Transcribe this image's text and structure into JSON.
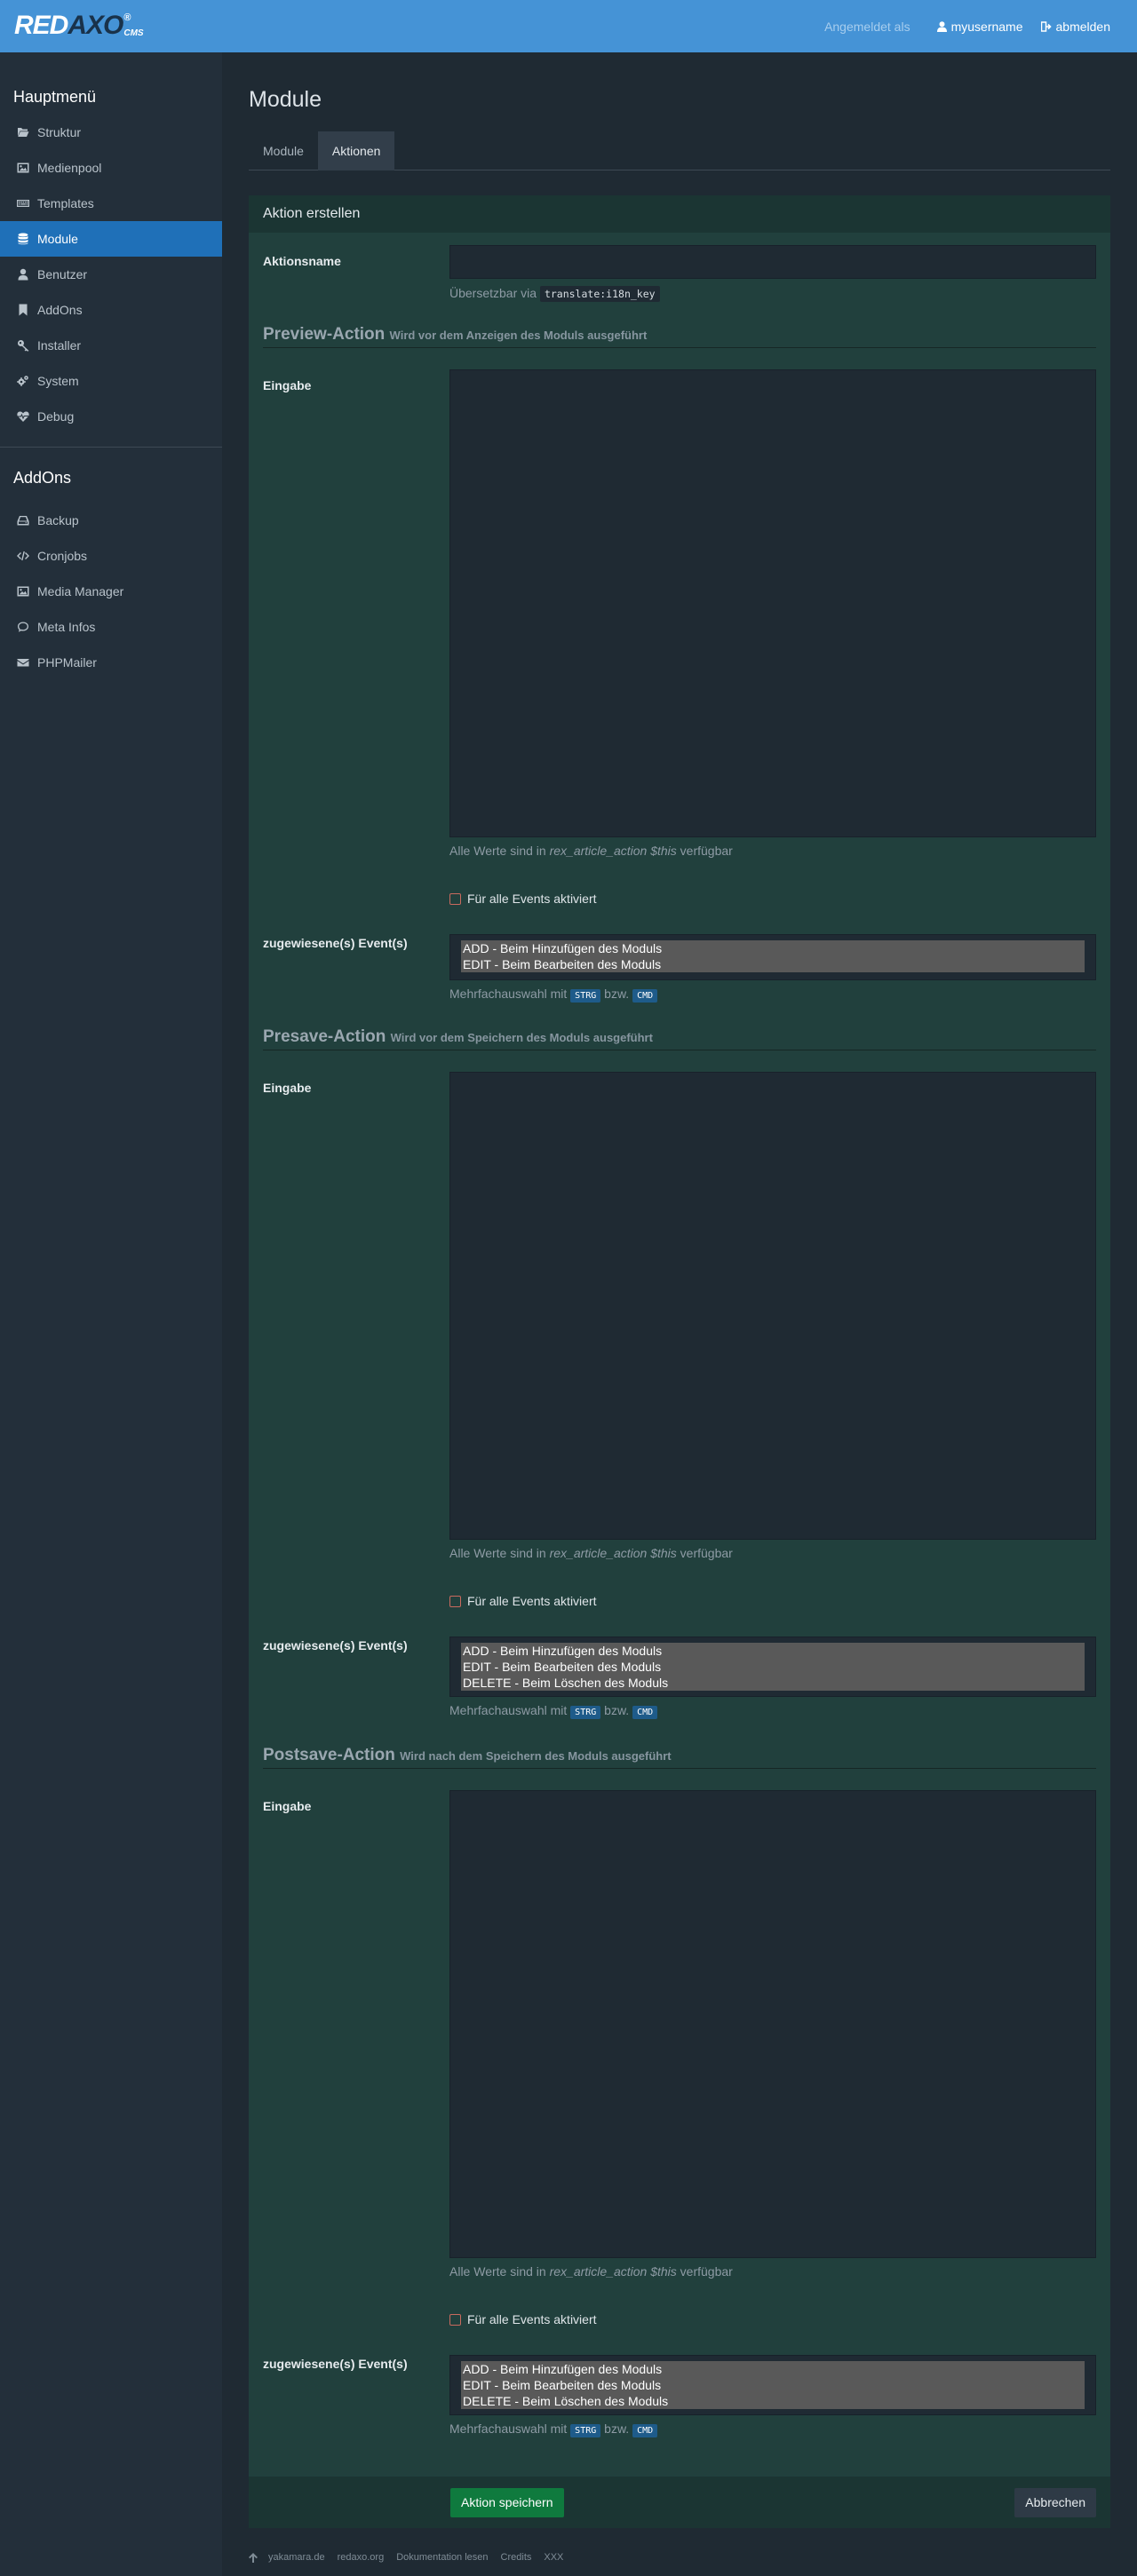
{
  "header": {
    "logo_red": "RED",
    "logo_axo": "AXO",
    "logo_reg": "®",
    "logo_cms": "CMS",
    "logged_in_as": "Angemeldet als",
    "username": "myusername",
    "logout": "abmelden"
  },
  "sidebar": {
    "main_title": "Hauptmenü",
    "main_items": [
      {
        "label": "Struktur",
        "icon": "folder-open-icon"
      },
      {
        "label": "Medienpool",
        "icon": "image-icon"
      },
      {
        "label": "Templates",
        "icon": "keyboard-icon"
      },
      {
        "label": "Module",
        "icon": "database-icon"
      },
      {
        "label": "Benutzer",
        "icon": "user-icon"
      },
      {
        "label": "AddOns",
        "icon": "bookmark-icon"
      },
      {
        "label": "Installer",
        "icon": "key-icon"
      },
      {
        "label": "System",
        "icon": "gears-icon"
      },
      {
        "label": "Debug",
        "icon": "heartbeat-icon"
      }
    ],
    "active_item": "Module",
    "addons_title": "AddOns",
    "addon_items": [
      {
        "label": "Backup",
        "icon": "hdd-icon"
      },
      {
        "label": "Cronjobs",
        "icon": "code-icon"
      },
      {
        "label": "Media Manager",
        "icon": "image-icon"
      },
      {
        "label": "Meta Infos",
        "icon": "comment-icon"
      },
      {
        "label": "PHPMailer",
        "icon": "envelope-icon"
      }
    ]
  },
  "main": {
    "title": "Module",
    "tabs": [
      {
        "label": "Module",
        "active": false
      },
      {
        "label": "Aktionen",
        "active": true
      }
    ],
    "panel_title": "Aktion erstellen",
    "action_name_label": "Aktionsname",
    "action_name_value": "",
    "translate_help": "Übersetzbar via",
    "translate_key": "translate:i18n_key",
    "sections": [
      {
        "title": "Preview-Action",
        "subtitle": "Wird vor dem Anzeigen des Moduls ausgeführt",
        "input_label": "Eingabe",
        "help_pre": "Alle Werte sind in",
        "help_em": "rex_article_action $this",
        "help_post": "verfügbar",
        "checkbox_label": "Für alle Events aktiviert",
        "events_label": "zugewiesene(s) Event(s)",
        "options": [
          "ADD - Beim Hinzufügen des Moduls",
          "EDIT - Beim Bearbeiten des Moduls"
        ]
      },
      {
        "title": "Presave-Action",
        "subtitle": "Wird vor dem Speichern des Moduls ausgeführt",
        "input_label": "Eingabe",
        "help_pre": "Alle Werte sind in",
        "help_em": "rex_article_action $this",
        "help_post": "verfügbar",
        "checkbox_label": "Für alle Events aktiviert",
        "events_label": "zugewiesene(s) Event(s)",
        "options": [
          "ADD - Beim Hinzufügen des Moduls",
          "EDIT - Beim Bearbeiten des Moduls",
          "DELETE - Beim Löschen des Moduls"
        ]
      },
      {
        "title": "Postsave-Action",
        "subtitle": "Wird nach dem Speichern des Moduls ausgeführt",
        "input_label": "Eingabe",
        "help_pre": "Alle Werte sind in",
        "help_em": "rex_article_action $this",
        "help_post": "verfügbar",
        "checkbox_label": "Für alle Events aktiviert",
        "events_label": "zugewiesene(s) Event(s)",
        "options": [
          "ADD - Beim Hinzufügen des Moduls",
          "EDIT - Beim Bearbeiten des Moduls",
          "DELETE - Beim Löschen des Moduls"
        ]
      }
    ],
    "multi_help_pre": "Mehrfachauswahl mit",
    "multi_key1": "STRG",
    "multi_help_mid": "bzw.",
    "multi_key2": "CMD",
    "save_button": "Aktion speichern",
    "cancel_button": "Abbrechen"
  },
  "footer": {
    "links": [
      "yakamara.de",
      "redaxo.org",
      "Dokumentation lesen",
      "Credits",
      "XXX"
    ]
  },
  "colors": {
    "topbar": "#4593d6",
    "sidebar": "#232f3a",
    "active": "#1f70b8",
    "panel": "#21403d",
    "save": "#0f7a3e"
  }
}
